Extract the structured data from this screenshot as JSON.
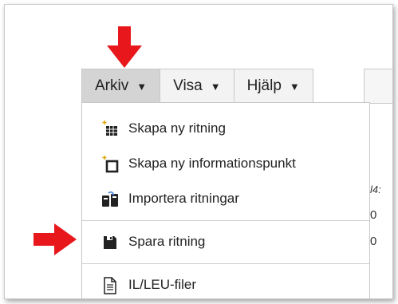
{
  "menubar": {
    "items": [
      {
        "label": "Arkiv",
        "caret": "▼"
      },
      {
        "label": "Visa",
        "caret": "▼"
      },
      {
        "label": "Hjälp",
        "caret": "▼"
      }
    ]
  },
  "dropdown": {
    "items": [
      {
        "label": "Skapa ny ritning",
        "icon": "new-drawing-icon"
      },
      {
        "label": "Skapa ny informationspunkt",
        "icon": "new-infopoint-icon"
      },
      {
        "label": "Importera ritningar",
        "icon": "import-icon"
      },
      {
        "label": "Spara ritning",
        "icon": "save-icon"
      },
      {
        "label": "IL/LEU-filer",
        "icon": "file-icon"
      }
    ]
  },
  "background": {
    "fragments": [
      "l4:",
      "0",
      "0"
    ]
  },
  "colors": {
    "arrow": "#e8171b",
    "menubar_bg": "#f3f3f3",
    "active_bg": "#d4d4d4"
  }
}
